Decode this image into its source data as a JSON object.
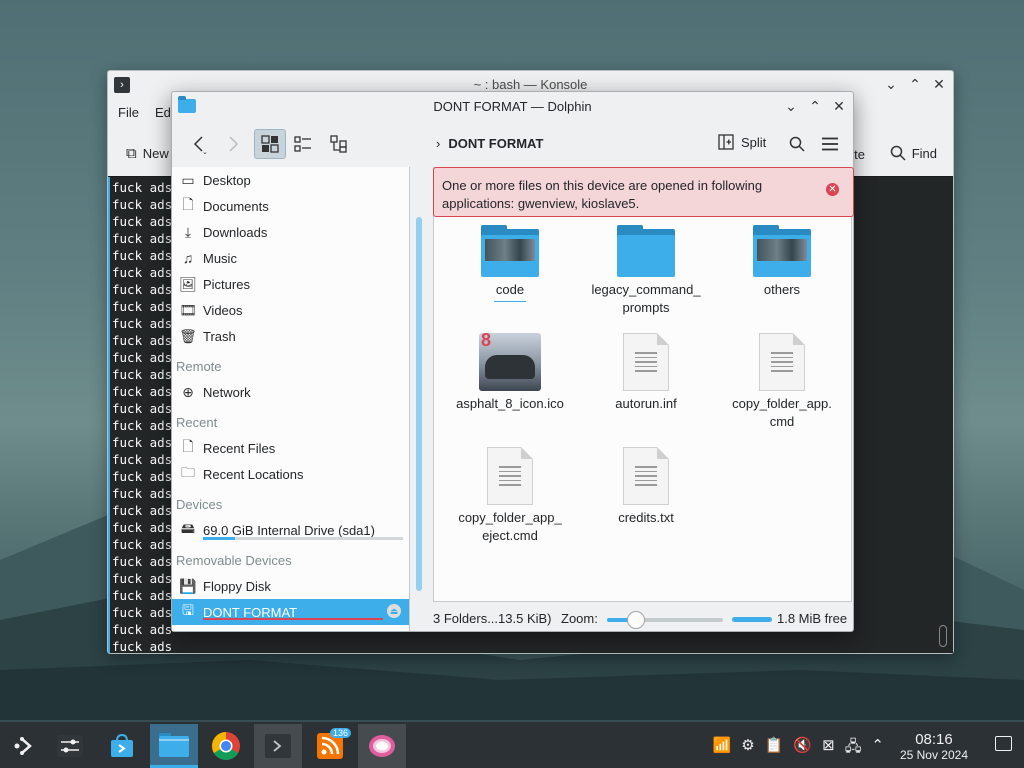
{
  "konsole": {
    "title": "~ : bash — Konsole",
    "menu": [
      "File",
      "Ed"
    ],
    "toolbar_new": "New",
    "toolbar_te": "te",
    "toolbar_find": "Find",
    "lines": [
      "fuck ads",
      "fuck ads",
      "fuck ads",
      "fuck ads",
      "fuck ads",
      "fuck ads",
      "fuck ads",
      "fuck ads",
      "fuck ads",
      "fuck ads",
      "fuck ads",
      "fuck ads",
      "fuck ads",
      "fuck ads",
      "fuck ads",
      "fuck ads",
      "fuck ads",
      "fuck ads",
      "fuck ads",
      "fuck ads",
      "fuck ads",
      "fuck ads",
      "fuck ads",
      "fuck ads",
      "fuck ads",
      "fuck ads",
      "fuck ads",
      "fuck ads"
    ]
  },
  "dolphin": {
    "title": "DONT FORMAT — Dolphin",
    "breadcrumb": "DONT FORMAT",
    "split_label": "Split",
    "places": {
      "main": [
        {
          "label": "Desktop",
          "icon": "desktop-icon"
        },
        {
          "label": "Documents",
          "icon": "documents-icon"
        },
        {
          "label": "Downloads",
          "icon": "downloads-icon"
        },
        {
          "label": "Music",
          "icon": "music-icon"
        },
        {
          "label": "Pictures",
          "icon": "pictures-icon"
        },
        {
          "label": "Videos",
          "icon": "videos-icon"
        },
        {
          "label": "Trash",
          "icon": "trash-icon"
        }
      ],
      "remote_header": "Remote",
      "remote": [
        {
          "label": "Network",
          "icon": "network-icon"
        }
      ],
      "recent_header": "Recent",
      "recent": [
        {
          "label": "Recent Files",
          "icon": "recent-files-icon"
        },
        {
          "label": "Recent Locations",
          "icon": "recent-locations-icon"
        }
      ],
      "devices_header": "Devices",
      "devices": [
        {
          "label": "69.0 GiB Internal Drive (sda1)",
          "icon": "drive-icon",
          "usage": 0.16
        }
      ],
      "removable_header": "Removable Devices",
      "removable": [
        {
          "label": "Floppy Disk",
          "icon": "floppy-icon"
        },
        {
          "label": "DONT FORMAT",
          "icon": "usb-drive-icon",
          "selected": true
        }
      ]
    },
    "notice": "One or more files on this device are opened in following applications: gwenview, kioslave5.",
    "files": [
      {
        "name": "code",
        "type": "folder-preview"
      },
      {
        "name": "legacy_command_\nprompts",
        "type": "folder"
      },
      {
        "name": "others",
        "type": "folder-preview"
      },
      {
        "name": "asphalt_8_icon.ico",
        "type": "image"
      },
      {
        "name": "autorun.inf",
        "type": "text"
      },
      {
        "name": "copy_folder_app.\ncmd",
        "type": "text"
      },
      {
        "name": "copy_folder_app_\neject.cmd",
        "type": "text"
      },
      {
        "name": "credits.txt",
        "type": "text"
      }
    ],
    "status": {
      "summary": "3 Folders...13.5 KiB)",
      "zoom_label": "Zoom:",
      "zoom_level": 0.25,
      "free": "1.8 MiB free"
    }
  },
  "taskbar": {
    "time": "08:16",
    "date": "25 Nov 2024",
    "rss_badge": "136"
  },
  "colors": {
    "accent": "#3daee9",
    "error": "#da4453"
  }
}
